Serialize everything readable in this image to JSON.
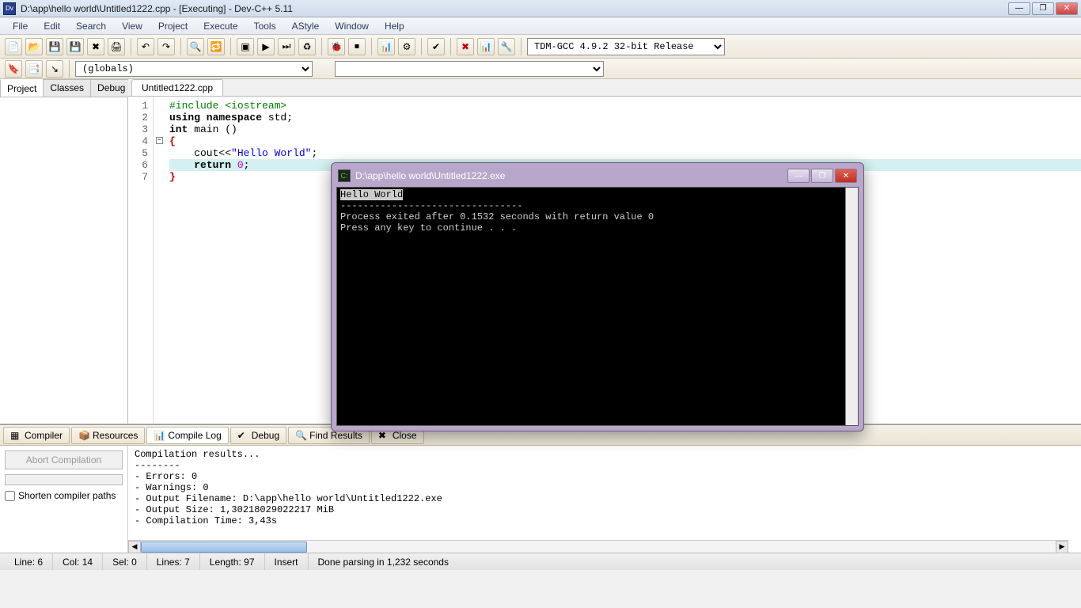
{
  "window": {
    "title": "D:\\app\\hello world\\Untitled1222.cpp - [Executing] - Dev-C++ 5.11"
  },
  "menu": {
    "items": [
      "File",
      "Edit",
      "Search",
      "View",
      "Project",
      "Execute",
      "Tools",
      "AStyle",
      "Window",
      "Help"
    ]
  },
  "toolbar": {
    "compiler_select": "TDM-GCC 4.9.2 32-bit Release",
    "globals_select": "(globals)"
  },
  "left_panel": {
    "tabs": [
      "Project",
      "Classes",
      "Debug"
    ],
    "active": 0
  },
  "editor": {
    "tab": "Untitled1222.cpp",
    "lines": [
      {
        "n": "1",
        "html": "<span class='pp'>#include &lt;iostream&gt;</span>"
      },
      {
        "n": "2",
        "html": "<span class='kw'>using namespace</span> std;"
      },
      {
        "n": "3",
        "html": "<span class='kw'>int</span> main ()"
      },
      {
        "n": "4",
        "html": "<span class='br'>{</span>",
        "fold": true
      },
      {
        "n": "5",
        "html": "    cout&lt;&lt;<span class='str'>\"Hello World\"</span>;"
      },
      {
        "n": "6",
        "html": "    <span class='kw'>return</span> <span class='num'>0</span>;",
        "hl": true
      },
      {
        "n": "7",
        "html": "<span class='br'>}</span>"
      }
    ]
  },
  "bottom": {
    "tabs": [
      {
        "label": "Compiler",
        "icon": "compiler-icon"
      },
      {
        "label": "Resources",
        "icon": "resources-icon"
      },
      {
        "label": "Compile Log",
        "icon": "compile-log-icon",
        "active": true
      },
      {
        "label": "Debug",
        "icon": "debug-icon"
      },
      {
        "label": "Find Results",
        "icon": "find-icon"
      },
      {
        "label": "Close",
        "icon": "close-icon"
      }
    ],
    "abort_label": "Abort Compilation",
    "shorten_label": "Shorten compiler paths",
    "log": "Compilation results...\n--------\n- Errors: 0\n- Warnings: 0\n- Output Filename: D:\\app\\hello world\\Untitled1222.exe\n- Output Size: 1,30218029022217 MiB\n- Compilation Time: 3,43s"
  },
  "status": {
    "line": "Line:   6",
    "col": "Col:   14",
    "sel": "Sel:   0",
    "lines": "Lines:   7",
    "length": "Length:   97",
    "mode": "Insert",
    "parse": "Done parsing in 1,232 seconds"
  },
  "console": {
    "title": "D:\\app\\hello world\\Untitled1222.exe",
    "lines": [
      {
        "text": "Hello World",
        "hl": true
      },
      {
        "text": "--------------------------------"
      },
      {
        "text": "Process exited after 0.1532 seconds with return value 0"
      },
      {
        "text": "Press any key to continue . . ."
      }
    ]
  }
}
